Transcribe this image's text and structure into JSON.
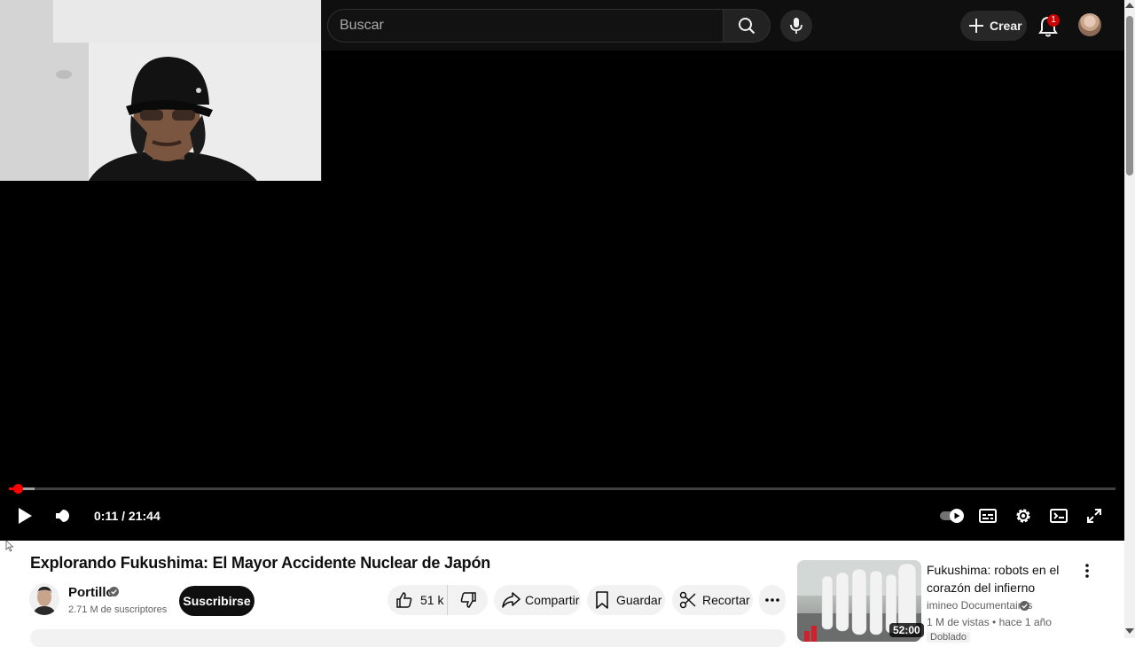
{
  "header": {
    "search_placeholder": "Buscar",
    "create_label": "Crear",
    "notification_count": "1"
  },
  "player": {
    "time_display": "0:11 / 21:44",
    "progress_played_fraction": 0.008,
    "progress_loaded_fraction": 0.023
  },
  "video": {
    "title": "Explorando Fukushima: El Mayor Accidente Nuclear de Japón",
    "channel_name": "Portillo",
    "subscribers": "2.71 M de suscriptores",
    "subscribe_label": "Suscribirse",
    "likes": "51 k",
    "share_label": "Compartir",
    "save_label": "Guardar",
    "clip_label": "Recortar"
  },
  "recommendation": {
    "title": "Fukushima: robots en el corazón del infierno",
    "channel": "imineo Documentaires",
    "meta": "1 M de vistas • hace 1 año",
    "duration": "52:00",
    "badge": "Doblado"
  },
  "colors": {
    "accent": "#ff0000",
    "header_bg": "#0f0f0f",
    "pill_bg": "#f2f2f2"
  },
  "icons": [
    "search-icon",
    "mic-icon",
    "plus-icon",
    "bell-icon",
    "play-icon",
    "volume-icon",
    "autoplay-toggle-icon",
    "subtitles-icon",
    "settings-icon",
    "miniplayer-icon",
    "fullscreen-icon",
    "thumb-up-icon",
    "thumb-down-icon",
    "share-icon",
    "bookmark-icon",
    "scissors-icon",
    "more-horiz-icon",
    "more-vert-icon",
    "verified-icon"
  ]
}
